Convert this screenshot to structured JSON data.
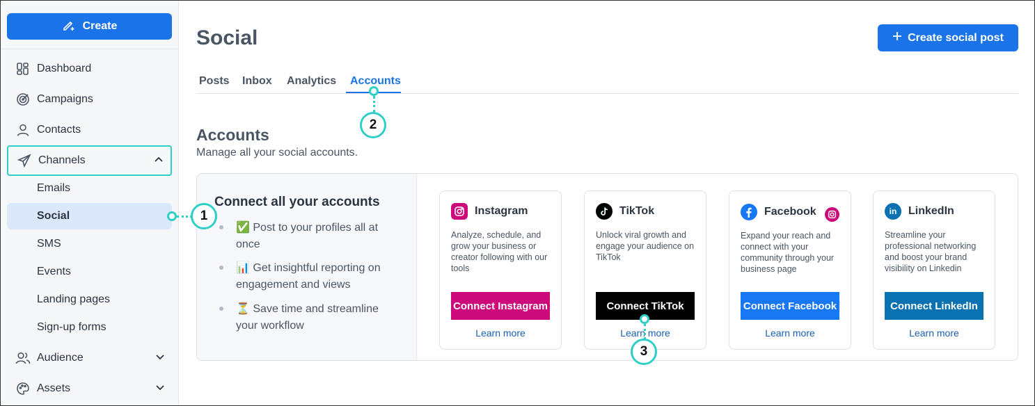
{
  "sidebar": {
    "create_label": "Create",
    "items": [
      {
        "label": "Dashboard",
        "icon": "dashboard-icon"
      },
      {
        "label": "Campaigns",
        "icon": "target-icon"
      },
      {
        "label": "Contacts",
        "icon": "person-icon"
      },
      {
        "label": "Channels",
        "icon": "paper-plane-icon",
        "expanded": true
      },
      {
        "label": "Audience",
        "icon": "people-icon"
      },
      {
        "label": "Assets",
        "icon": "palette-icon"
      }
    ],
    "channels_sub": [
      "Emails",
      "Social",
      "SMS",
      "Events",
      "Landing pages",
      "Sign-up forms"
    ],
    "active_sub": "Social"
  },
  "header": {
    "title": "Social",
    "primary_button": "Create social post"
  },
  "tabs": [
    "Posts",
    "Inbox",
    "Analytics",
    "Accounts"
  ],
  "active_tab": "Accounts",
  "section": {
    "title": "Accounts",
    "subtitle": "Manage all your social accounts."
  },
  "connect_panel": {
    "heading": "Connect all your accounts",
    "bullets": [
      {
        "emoji": "✅",
        "text": "Post to your profiles all at once"
      },
      {
        "emoji": "📊",
        "text": "Get insightful reporting on engagement and views"
      },
      {
        "emoji": "⏳",
        "text": "Save time and streamline your workflow"
      }
    ]
  },
  "cards": [
    {
      "name": "Instagram",
      "icon": "instagram-icon",
      "description": "Analyze, schedule, and grow your business or creator following with our tools",
      "button": "Connect Instagram",
      "link": "Learn more",
      "button_color": "#cc0a7a"
    },
    {
      "name": "TikTok",
      "icon": "tiktok-icon",
      "description": "Unlock viral growth and engage your audience on TikTok",
      "button": "Connect TikTok",
      "link": "Learn more",
      "button_color": "#000000"
    },
    {
      "name": "Facebook",
      "icon": "facebook-icon",
      "description": "Expand your reach and connect with your community through your business page",
      "button": "Connect Facebook",
      "link": "Learn more",
      "button_color": "#1877f2"
    },
    {
      "name": "LinkedIn",
      "icon": "linkedin-icon",
      "description": "Streamline your professional networking and boost your brand visibility on Linkedin",
      "button": "Connect LinkedIn",
      "link": "Learn more",
      "button_color": "#0a72b1"
    }
  ],
  "callouts": [
    "1",
    "2",
    "3"
  ],
  "colors": {
    "accent": "#1a73e8",
    "callout": "#2ecfc6"
  }
}
